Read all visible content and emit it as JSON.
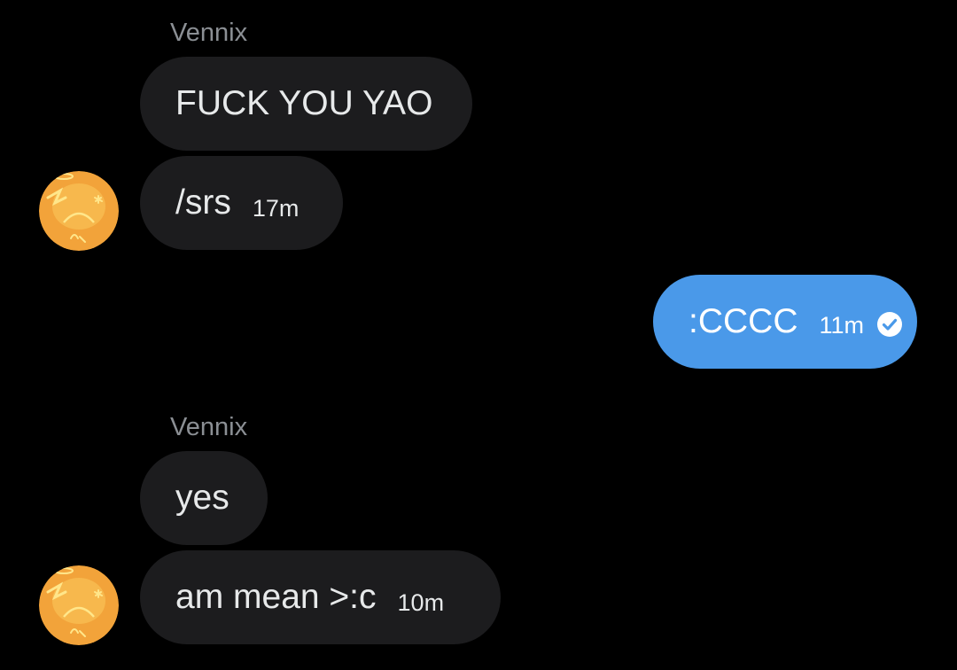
{
  "messages": {
    "group1": {
      "sender": "Vennix",
      "bubble1_text": "FUCK YOU YAO",
      "bubble2_text": "/srs",
      "bubble2_time": "17m",
      "avatar_icon": "orange-cartoon-avatar-icon"
    },
    "mine": {
      "text": ":CCCC",
      "time": "11m",
      "status_icon": "check-circle-icon"
    },
    "group2": {
      "sender": "Vennix",
      "bubble1_text": "yes",
      "bubble2_text": "am mean >:c",
      "bubble2_time": "10m",
      "avatar_icon": "orange-cartoon-avatar-icon"
    }
  },
  "colors": {
    "background": "#000000",
    "incoming_bubble": "#1c1c1e",
    "outgoing_bubble": "#4a99e9",
    "sender_name": "#8b8f94",
    "avatar_orange": "#f2a33a"
  }
}
